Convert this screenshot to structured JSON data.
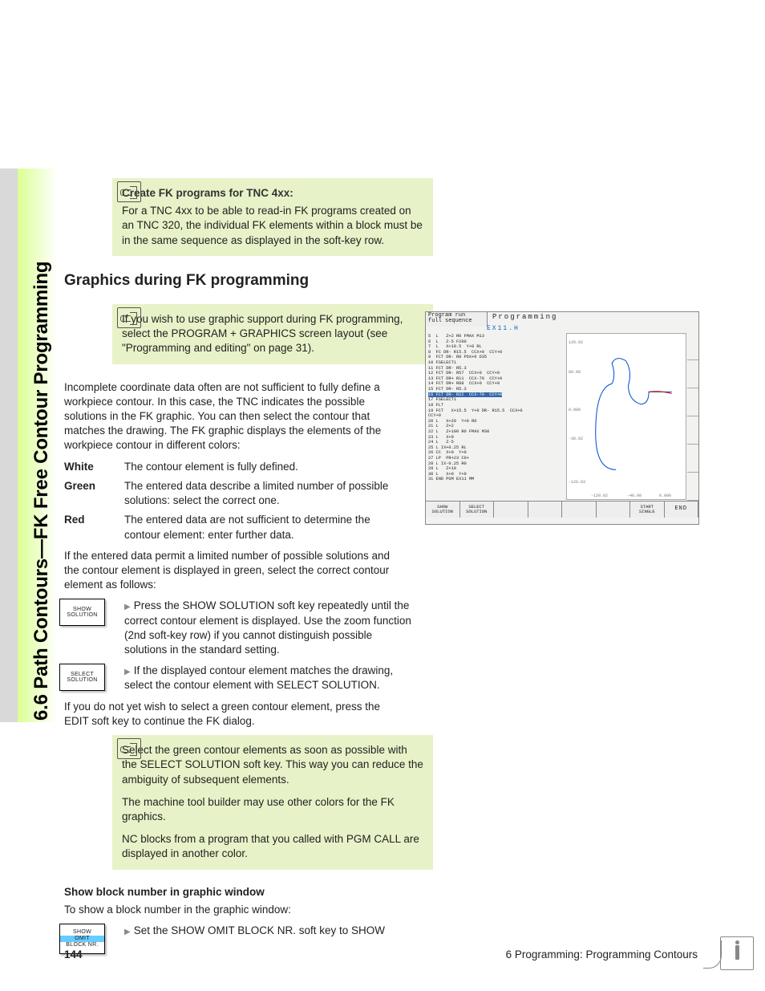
{
  "sidebar_title": "6.6 Path Contours—FK Free Contour Programming",
  "note1": {
    "title": "Create FK programs for TNC 4xx:",
    "body": "For a TNC 4xx to be able to read-in FK programs created on an TNC 320, the individual FK elements within a block must be in the same sequence as displayed in the soft-key row."
  },
  "h2": "Graphics during FK programming",
  "note2": {
    "body": "If you wish to use graphic support during FK programming, select the PROGRAM + GRAPHICS screen layout (see \"Programming and editing\" on page 31)."
  },
  "p1": "Incomplete coordinate data often are not sufficient to fully define a workpiece contour. In this case, the TNC indicates the possible solutions in the FK graphic. You can then select the contour that matches the drawing. The FK graphic displays the elements of the workpiece contour in different colors:",
  "colors": [
    {
      "label": "White",
      "desc": "The contour element is fully defined."
    },
    {
      "label": "Green",
      "desc": "The entered data describe a limited number of possible solutions: select the correct one."
    },
    {
      "label": "Red",
      "desc": "The entered data are not sufficient to determine the contour element: enter further data."
    }
  ],
  "p2": "If the entered data permit a limited number of possible solutions and the contour element is displayed in green, select the correct contour element as follows:",
  "softkeys": {
    "show": {
      "l1": "SHOW",
      "l2": "SOLUTION"
    },
    "select": {
      "l1": "SELECT",
      "l2": "SOLUTION"
    },
    "omit": {
      "l1": "SHOW",
      "l2": "OMIT",
      "l3": "BLOCK NR."
    }
  },
  "sk1_text": "Press the SHOW SOLUTION soft key repeatedly until the correct contour element is displayed. Use the zoom function (2nd soft-key row) if you cannot distinguish possible solutions in the standard setting.",
  "sk2_text": "If the displayed contour element matches the drawing, select the contour element with SELECT SOLUTION.",
  "p3": "If you do not yet wish to select a green contour element, press the EDIT soft key to continue the FK dialog.",
  "note3": {
    "l1": "Select the green contour elements as soon as possible with the SELECT SOLUTION soft key. This way you can reduce the ambiguity of subsequent elements.",
    "l2": "The machine tool builder may use other colors for the FK graphics.",
    "l3": "NC blocks from a program that you called with PGM CALL are displayed in another color."
  },
  "h3": "Show block number in graphic window",
  "p4": "To show a block number in the graphic window:",
  "sk3_text": "Set the SHOW OMIT BLOCK NR. soft key to SHOW",
  "screenshot": {
    "mode_left_l1": "Program run",
    "mode_left_l2": "full sequence",
    "mode_right": "Programming",
    "filename": "EX11.H",
    "code": "5  L   Z+2 R0 FMAX M13\n6  L   Z-5 F200\n7  L   X+19.5  Y+0 RL\n8  FC DR- R15.5  CCX+0  CCY+0\n9  FCT DR- R8 PDX+0 D35\n10 FSELECT1\n11 FCT DR- R5.3\n12 FCT DR- R57  CCX+0  CCY+0\n13 FCT DR+ R11  CCX-70  CCY+0\n14 FCT DR+ R88  CCX+0  CCY+0\n15 FCT DR- R5.3",
    "code_hl": "16 FCT DR- R22  CCX-70  CCY+0",
    "code2": "17 FSELECT1\n18 FLT\n19 FCT   X+15.5  Y+0 DR- R15.5  CCX+0\nCCY+0\n20 L   X+20  Y+0 R0\n21 L   Z+2\n22 L   Z+100 R0 FMAX M30\n23 L   X+0\n24 L   Z-5\n25 L IX+0.25 RL\n26 CC  X+0  Y+0\n27 LP  PR+23 C0+\n28 L IX-0.25 R0\n29 L   Z+10\n30 L   X+0  Y+0\n31 END PGM EX11 MM",
    "yticks": [
      "120.02",
      "80.00",
      "0.000",
      "-30.02",
      "-120.03"
    ],
    "xticks": [
      "-120.02",
      "-40.00",
      "0.000"
    ],
    "footer": {
      "b1": {
        "l1": "SHOW",
        "l2": "SOLUTION"
      },
      "b2": {
        "l1": "SELECT",
        "l2": "SOLUTION"
      },
      "b8": {
        "l1": "START",
        "l2": "SINGLE"
      },
      "b9": "END"
    }
  },
  "footer": {
    "page": "144",
    "chapter": "6 Programming: Programming Contours"
  }
}
